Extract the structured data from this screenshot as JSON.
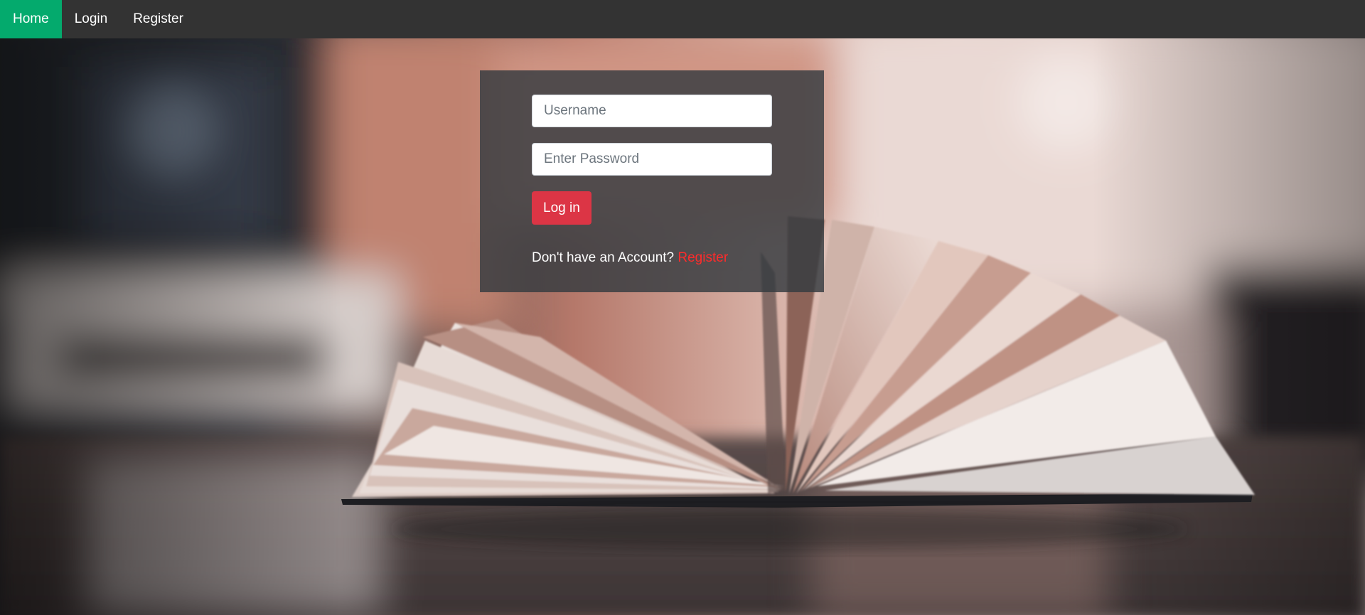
{
  "nav": {
    "items": [
      {
        "label": "Home",
        "active": true
      },
      {
        "label": "Login",
        "active": false
      },
      {
        "label": "Register",
        "active": false
      }
    ]
  },
  "login": {
    "username_placeholder": "Username",
    "username_value": "",
    "password_placeholder": "Enter Password",
    "password_value": "",
    "submit_label": "Log in",
    "no_account_text": "Don't have an Account? ",
    "register_link": "Register"
  },
  "colors": {
    "nav_bg": "#333333",
    "nav_active": "#04aa6d",
    "button": "#dc3545",
    "register_link": "#ff2b2b",
    "panel": "rgba(52, 58, 64, 0.82)"
  },
  "background": {
    "image": "open-book-on-table-icon"
  }
}
